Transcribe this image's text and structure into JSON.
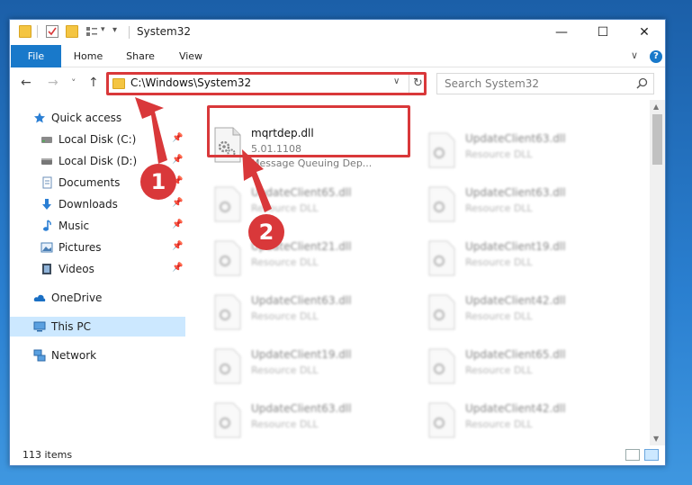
{
  "window": {
    "title": "System32",
    "qa_dropdown": "▾",
    "minimize": "—",
    "maximize": "☐",
    "close": "✕"
  },
  "ribbon": {
    "tabs": [
      "File",
      "Home",
      "Share",
      "View"
    ],
    "expand": "∨",
    "help": "?"
  },
  "nav": {
    "back": "←",
    "forward": "→",
    "recent": "˅",
    "up": "↑",
    "address": "C:\\Windows\\System32",
    "address_drop": "∨",
    "refresh": "↻",
    "search_placeholder": "Search System32"
  },
  "sidebar": {
    "items": [
      {
        "label": "Quick access",
        "icon": "star-icon",
        "pinned": false
      },
      {
        "label": "Local Disk (C:)",
        "icon": "drive-icon",
        "pinned": true
      },
      {
        "label": "Local Disk (D:)",
        "icon": "drive-icon",
        "pinned": true
      },
      {
        "label": "Documents",
        "icon": "documents-icon",
        "pinned": true
      },
      {
        "label": "Downloads",
        "icon": "download-icon",
        "pinned": true
      },
      {
        "label": "Music",
        "icon": "music-icon",
        "pinned": true
      },
      {
        "label": "Pictures",
        "icon": "pictures-icon",
        "pinned": true
      },
      {
        "label": "Videos",
        "icon": "videos-icon",
        "pinned": true
      },
      {
        "label": "OneDrive",
        "icon": "cloud-icon",
        "pinned": false
      },
      {
        "label": "This PC",
        "icon": "computer-icon",
        "pinned": false
      },
      {
        "label": "Network",
        "icon": "network-icon",
        "pinned": false
      }
    ],
    "selected": "This PC",
    "pin_glyph": "📌"
  },
  "files": {
    "highlighted": {
      "name": "mqrtdep.dll",
      "version": "5.01.1108",
      "description": "Message Queuing Dep..."
    },
    "right_column": [
      {
        "name": "UpdateClient63.dll",
        "type": "Resource DLL"
      },
      {
        "name": "UpdateClient63.dll",
        "type": "Resource DLL"
      },
      {
        "name": "UpdateClient19.dll",
        "type": "Resource DLL"
      },
      {
        "name": "UpdateClient42.dll",
        "type": "Resource DLL"
      },
      {
        "name": "UpdateClient65.dll",
        "type": "Resource DLL"
      },
      {
        "name": "UpdateClient42.dll",
        "type": "Resource DLL"
      }
    ],
    "left_column": [
      {
        "name": "UpdateClient65.dll",
        "type": "Resource DLL"
      },
      {
        "name": "UpdateClient21.dll",
        "type": "Resource DLL"
      },
      {
        "name": "UpdateClient63.dll",
        "type": "Resource DLL"
      },
      {
        "name": "UpdateClient19.dll",
        "type": "Resource DLL"
      },
      {
        "name": "UpdateClient63.dll",
        "type": "Resource DLL"
      }
    ]
  },
  "status": {
    "count": "113 items"
  },
  "annotations": {
    "step1": "1",
    "step2": "2"
  },
  "colors": {
    "accent": "#1979ca",
    "highlight": "#d9383a",
    "selected_bg": "#cce8ff"
  }
}
